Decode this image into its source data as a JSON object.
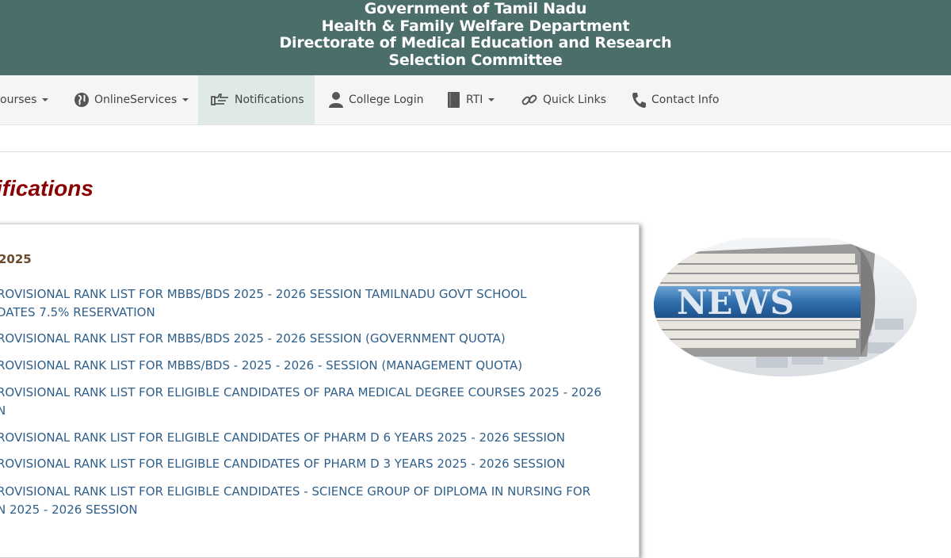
{
  "header": {
    "line1": "Government of Tamil Nadu",
    "line2": "Health & Family Welfare Department",
    "line3": "Directorate of Medical Education and Research",
    "line4": "Selection Committee"
  },
  "nav": {
    "courses": "ourses",
    "online_services": "OnlineServices",
    "notifications": "Notifications",
    "college_login": "College Login",
    "rti": "RTI",
    "quick_links": "Quick Links",
    "contact_info": "Contact Info"
  },
  "page": {
    "title": "ifications",
    "year": "2025"
  },
  "notifications": [
    {
      "line1": "ROVISIONAL RANK LIST FOR MBBS/BDS 2025 - 2026 SESSION TAMILNADU GOVT SCHOOL",
      "line2": "DATES 7.5% RESERVATION"
    },
    {
      "line1": "ROVISIONAL RANK LIST FOR MBBS/BDS 2025 - 2026 SESSION (GOVERNMENT QUOTA)",
      "line2": ""
    },
    {
      "line1": "ROVISIONAL RANK LIST FOR MBBS/BDS - 2025 - 2026 - SESSION (MANAGEMENT QUOTA)",
      "line2": ""
    },
    {
      "line1": "ROVISIONAL RANK LIST FOR ELIGIBLE CANDIDATES OF PARA MEDICAL DEGREE COURSES 2025 - 2026",
      "line2": "N"
    },
    {
      "line1": "ROVISIONAL RANK LIST FOR ELIGIBLE CANDIDATES OF PHARM D 6 YEARS 2025 - 2026 SESSION",
      "line2": ""
    },
    {
      "line1": "ROVISIONAL RANK LIST FOR ELIGIBLE CANDIDATES OF PHARM D 3 YEARS 2025 - 2026 SESSION",
      "line2": ""
    },
    {
      "line1": "ROVISIONAL RANK LIST FOR ELIGIBLE CANDIDATES - SCIENCE GROUP OF DIPLOMA IN NURSING FOR",
      "line2": "N 2025 - 2026 SESSION"
    }
  ],
  "news_image": {
    "label": "NEWS"
  },
  "colors": {
    "header_bg": "#4b6e6b",
    "title": "#8b0000",
    "link": "#2f5f8a",
    "active_tab": "#dfe9e8"
  }
}
